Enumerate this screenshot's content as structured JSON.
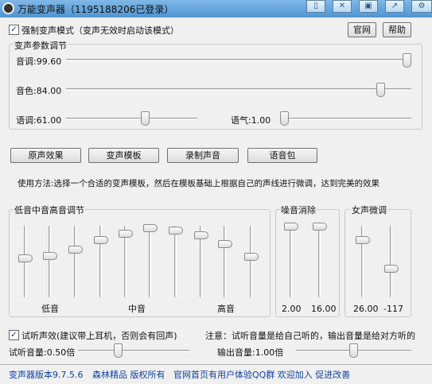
{
  "title_bar": {
    "title": "万能变声器（1195188206已登录）",
    "buttons": [
      "restore-icon",
      "shrink-icon",
      "save-icon",
      "share-icon",
      "gear-icon"
    ]
  },
  "toolbar": {
    "forced_mode_checked": true,
    "forced_mode_label": "强制变声模式（变声无效时启动该模式）",
    "official_site": "官网",
    "help": "帮助"
  },
  "params": {
    "title": "变声参数调节",
    "pitch_label": "音调:99.60",
    "pitch_value": 99.6,
    "timbre_label": "音色:84.00",
    "timbre_value": 84.0,
    "speech_label": "语调:61.00",
    "speech_value": 61.0,
    "tone_label": "语气:1.00",
    "tone_value": 1.0
  },
  "actions": {
    "original": "原声效果",
    "template": "变声模板",
    "record": "录制声音",
    "voice_pack": "语音包"
  },
  "usage_text": "使用方法:选择一个合适的变声模板，然后在模板基础上根据自己的声线进行微调，达到完美的效果",
  "eq": {
    "title": "低音中音高音调节",
    "low": "低音",
    "mid": "中音",
    "high": "高音",
    "levels": [
      0.47,
      0.43,
      0.34,
      0.2,
      0.1,
      0.02,
      0.06,
      0.13,
      0.25,
      0.44
    ]
  },
  "noise": {
    "title": "噪音消除",
    "values": [
      "2.00",
      "16.00"
    ],
    "levels": [
      0.0,
      0.0
    ]
  },
  "female": {
    "title": "女声微调",
    "values": [
      "26.00",
      "-117"
    ],
    "levels": [
      0.2,
      0.62
    ]
  },
  "monitor": {
    "checked": true,
    "label": "试听声效(建议带上耳机，否则会有回声)",
    "note": "注意：试听音量是给自己听的，输出音量是给对方听的",
    "listen_label": "试听音量:0.50倍",
    "listen_value": 0.5,
    "output_label": "输出音量:1.00倍",
    "output_value": 1.0
  },
  "footer": {
    "version": "变声器版本9.7.5.6",
    "company": "森林精品 版权所有",
    "homepage": "官网首页有用户体验QQ群 欢迎加入 促进改善"
  }
}
